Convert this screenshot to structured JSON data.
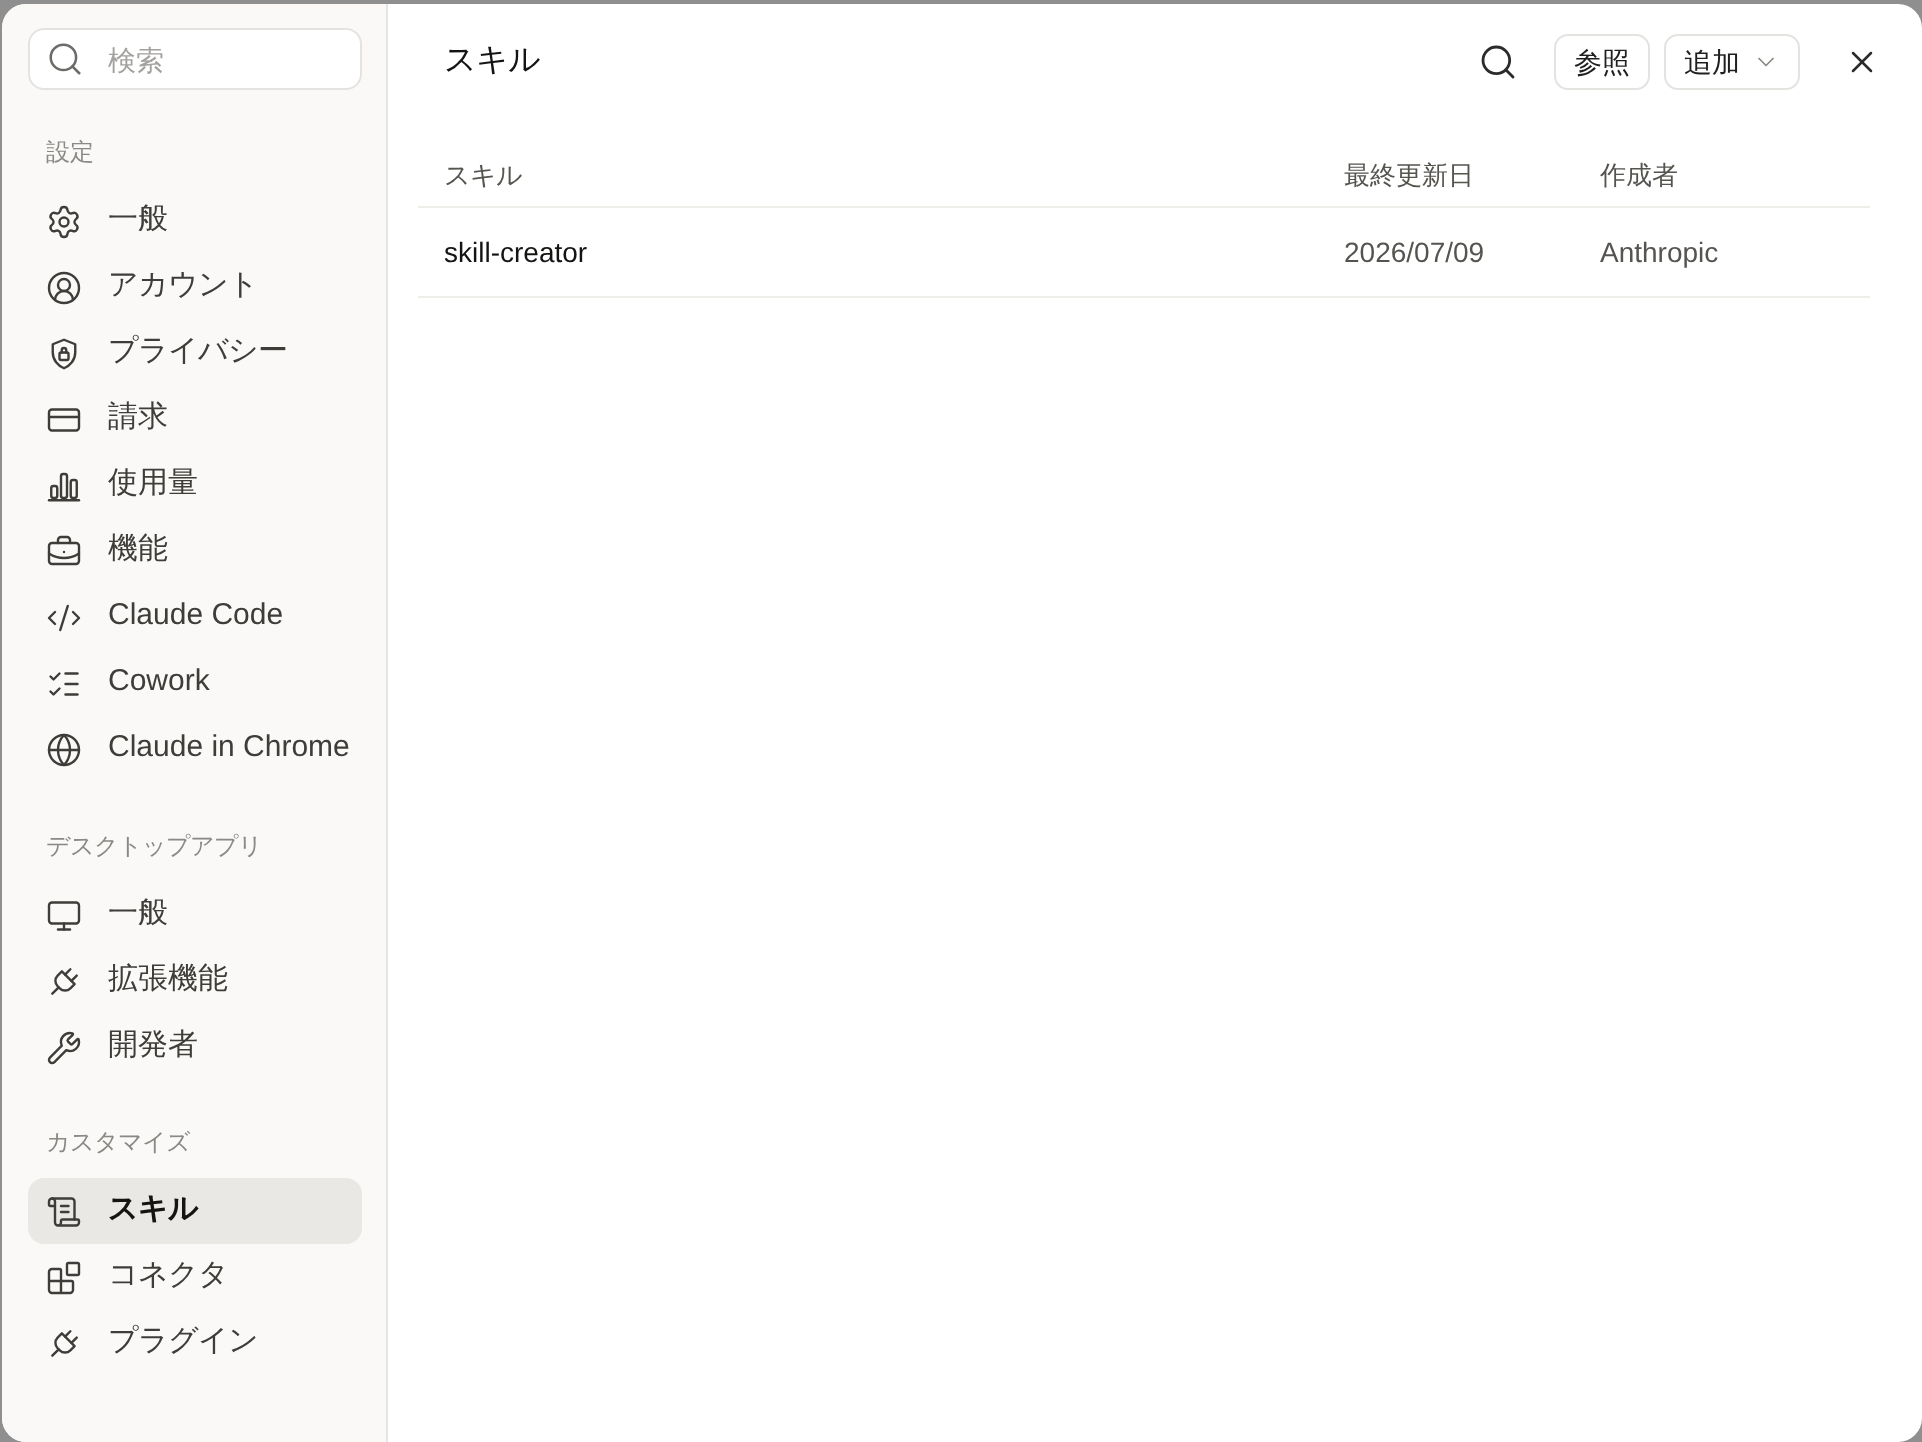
{
  "search": {
    "placeholder": "検索"
  },
  "sidebar": {
    "sections": [
      {
        "title": "設定",
        "items": [
          {
            "label": "一般",
            "selected": false
          },
          {
            "label": "アカウント",
            "selected": false
          },
          {
            "label": "プライバシー",
            "selected": false
          },
          {
            "label": "請求",
            "selected": false
          },
          {
            "label": "使用量",
            "selected": false
          },
          {
            "label": "機能",
            "selected": false
          },
          {
            "label": "Claude Code",
            "selected": false
          },
          {
            "label": "Cowork",
            "selected": false
          },
          {
            "label": "Claude in Chrome",
            "selected": false
          }
        ]
      },
      {
        "title": "デスクトップアプリ",
        "items": [
          {
            "label": "一般",
            "selected": false
          },
          {
            "label": "拡張機能",
            "selected": false
          },
          {
            "label": "開発者",
            "selected": false
          }
        ]
      },
      {
        "title": "カスタマイズ",
        "items": [
          {
            "label": "スキル",
            "selected": true
          },
          {
            "label": "コネクタ",
            "selected": false
          },
          {
            "label": "プラグイン",
            "selected": false
          }
        ]
      }
    ]
  },
  "header": {
    "title": "スキル",
    "buttons": [
      {
        "label": "参照",
        "dropdown": false
      },
      {
        "label": "追加",
        "dropdown": true
      }
    ]
  },
  "table": {
    "columns": [
      "スキル",
      "最終更新日",
      "作成者"
    ],
    "rows": [
      {
        "cells": [
          "skill-creator",
          "2026/07/09",
          "Anthropic"
        ]
      }
    ]
  }
}
